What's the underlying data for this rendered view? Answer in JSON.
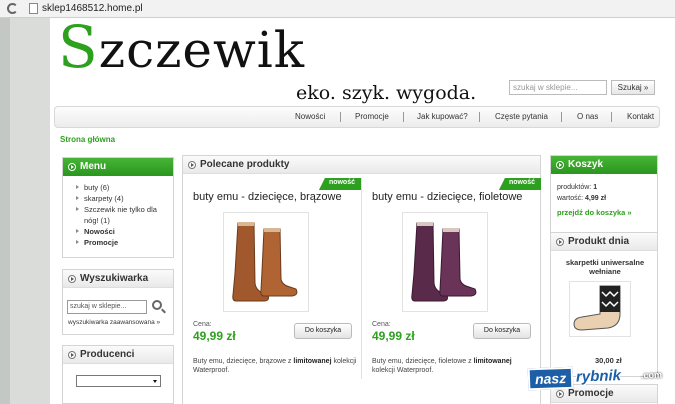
{
  "browser": {
    "url": "sklep1468512.home.pl"
  },
  "header": {
    "logo_initial": "S",
    "logo_rest": "zczewik",
    "tagline": "eko. szyk. wygoda.",
    "search_placeholder": "szukaj w sklepie...",
    "search_button": "Szukaj »"
  },
  "nav": {
    "items": [
      "Nowości",
      "Promocje",
      "Jak kupować?",
      "Częste pytania",
      "O nas",
      "Kontakt"
    ]
  },
  "breadcrumb": "Strona główna",
  "menu": {
    "title": "Menu",
    "items": [
      {
        "label": "buty (6)",
        "bold": false
      },
      {
        "label": "skarpety  (4)",
        "bold": false
      },
      {
        "label": "Szczewik nie tylko dla nóg! (1)",
        "bold": false
      },
      {
        "label": "Nowości",
        "bold": true
      },
      {
        "label": "Promocje",
        "bold": true
      }
    ]
  },
  "finder": {
    "title": "Wyszukiwarka",
    "placeholder": "szukaj w sklepie...",
    "advanced_link": "wyszukiwarka zaawansowana »"
  },
  "producers": {
    "title": "Producenci"
  },
  "featured": {
    "title": "Polecane produkty",
    "products": [
      {
        "badge": "nowość",
        "title": "buty emu - dziecięce, brązowe",
        "price_label": "Cena:",
        "price": "49,99 zł",
        "cart_button": "Do koszyka",
        "desc_start": "Buty emu, dziecięce, brązowe z ",
        "desc_bold": "limitowanej",
        "desc_end": " kolekcji Waterproof.",
        "color": "#a0582c"
      },
      {
        "badge": "nowość",
        "title": "buty emu - dziecięce, fioletowe",
        "price_label": "Cena:",
        "price": "49,99 zł",
        "cart_button": "Do koszyka",
        "desc_start": "Buty emu, dziecięce, fioletowe z ",
        "desc_bold": "limitowanej",
        "desc_end": " kolekcji Waterproof.",
        "color": "#5a2a4a"
      }
    ]
  },
  "cart": {
    "title": "Koszyk",
    "products_label": "produktów:",
    "products_value": "1",
    "value_label": "wartość:",
    "value_value": "4,99 zł",
    "link": "przejdź do koszyka »"
  },
  "day_product": {
    "title": "Produkt dnia",
    "name": "skarpetki uniwersalne wełniane",
    "price": "30,00 zł"
  },
  "promo_box": {
    "title": "Promocje"
  },
  "watermark": {
    "part1": "nasz",
    "part2": "rybnik",
    "part3": ".com"
  },
  "colors": {
    "accent_green": "#2ea01f",
    "nav_bg": "#ececec"
  }
}
